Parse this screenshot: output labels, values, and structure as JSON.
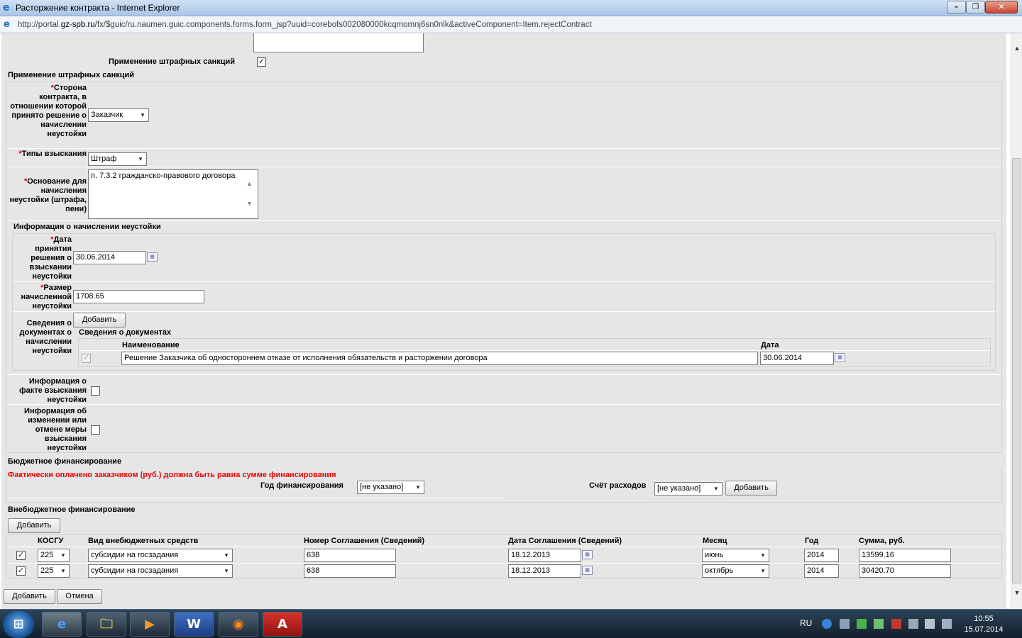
{
  "window": {
    "title": "Расторжение контракта - Internet Explorer",
    "url_prefix": "http://portal.",
    "url_host": "gz-spb.ru",
    "url_rest": "/fx/$guic/ru.naumen.guic.components.forms.form_jsp?uuid=corebofs002080000kcqmomnj6sn0nlk&activeComponent=Item.rejectContract",
    "min": "–",
    "max": "❐",
    "close": "✕"
  },
  "form": {
    "penalty_toggle_label": "Применение штрафных санкций",
    "penalty_toggle_checked": "✓",
    "penalty_section_title": "Применение штрафных санкций",
    "required_mark": "*",
    "party_label": "Сторона контракта, в отношении которой принято решение о начислении неустойки",
    "party_value": "Заказчик",
    "types_label": "Типы взыскания",
    "types_value": "Штраф",
    "basis_label": "Основание для начисления неустойки (штрафа, пени)",
    "basis_value": "п. 7.3.2 гражданско-правового договора",
    "accrual_section_title": "Информация о начислении неустойки",
    "decision_date_label": "Дата принятия решения о взыскании неустойки",
    "decision_date_value": "30.06.2014",
    "amount_label": "Размер начисленной неустойки",
    "amount_value": "1708.65",
    "docs_label": "Сведения о документах о начислении неустойки",
    "add_label": "Добавить",
    "docs_table_title": "Сведения о документах",
    "docs_col_name": "Наименование",
    "docs_col_date": "Дата",
    "doc_row": {
      "check": "✓",
      "name": "Решение Заказчика об одностороннем отказе от исполнения обязательств и расторжении договора",
      "date": "30.06.2014"
    },
    "fact_label": "Информация о факте взыскания неустойки",
    "change_label": "Информация об изменении или отмене меры взыскания неустойки"
  },
  "budget": {
    "title": "Бюджетное финансирование",
    "error": "Фактически оплачено заказчиком (руб.) должна быть равна сумме финансирования",
    "year_label": "Год финансирования",
    "year_value": "[не указано]",
    "account_label": "Счёт расходов",
    "account_value": "[не указано]",
    "add_label": "Добавить"
  },
  "extra": {
    "title": "Внебюджетное финансирование",
    "add_label": "Добавить",
    "columns": {
      "kosgu": "КОСГУ",
      "kind": "Вид внебюджетных средств",
      "agreement_no": "Номер Соглашения (Сведений)",
      "agreement_date": "Дата Соглашения (Сведений)",
      "month": "Месяц",
      "year": "Год",
      "sum": "Сумма, руб."
    },
    "rows": [
      {
        "check": "✓",
        "kosgu": "225",
        "kind": "субсидии на госзадания",
        "agreement_no": "638",
        "agreement_date": "18.12.2013",
        "month": "июнь",
        "year": "2014",
        "sum": "13599.16"
      },
      {
        "check": "✓",
        "kosgu": "225",
        "kind": "субсидии на госзадания",
        "agreement_no": "638",
        "agreement_date": "18.12.2013",
        "month": "октябрь",
        "year": "2014",
        "sum": "30420.70"
      }
    ]
  },
  "footer": {
    "add_label": "Добавить",
    "cancel_label": "Отмена"
  },
  "taskbar": {
    "lang": "RU",
    "time": "10:55",
    "date": "15.07.2014"
  },
  "icons": {
    "dropdown": "▾",
    "calendar": "▦",
    "start": "⊞",
    "ie": "e",
    "explorer": "🗀",
    "media": "▶",
    "word": "W",
    "firefox": "◉",
    "pdf": "A",
    "scroll_up": "▲",
    "scroll_down": "▼"
  },
  "colors": {
    "error": "#e00000",
    "panel": "#e6e6e6",
    "required": "#dd0000"
  }
}
